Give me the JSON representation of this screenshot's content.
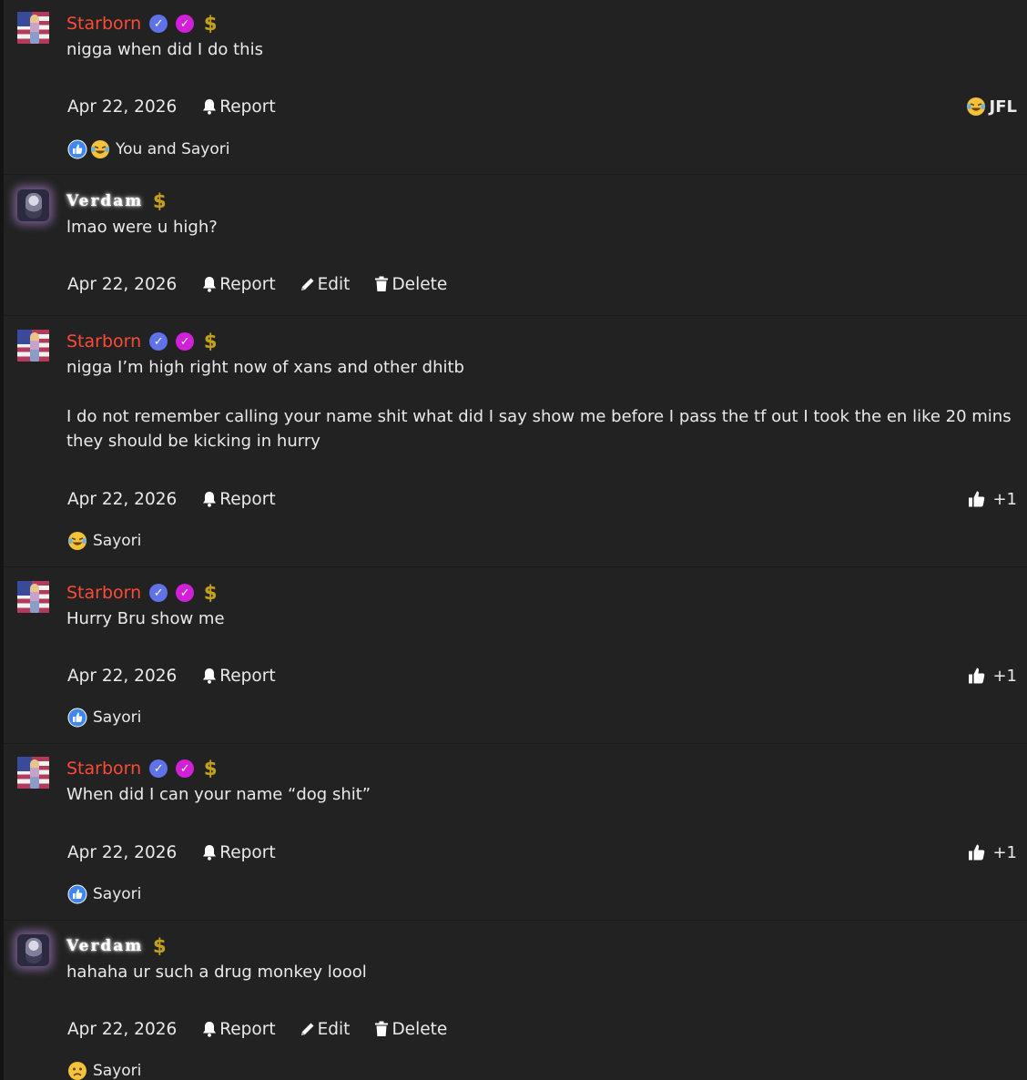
{
  "accent_colors": {
    "starborn_name": "#ff4a37",
    "verified_badge": "#5f72e8",
    "purple_badge": "#d21fd8",
    "dollar_badge": "#c2a020",
    "background": "#222222"
  },
  "posts": [
    {
      "author": "Starborn",
      "avatar_icon": "starborn-avatar",
      "badges": [
        "verified-icon",
        "purple-check-icon",
        "dollar-icon"
      ],
      "body": [
        "nigga when did I do this"
      ],
      "date": "Apr 22, 2026",
      "actions": {
        "report": "Report"
      },
      "right_reaction": {
        "icon": "laughing-crying-emoji-icon",
        "label": "JFL"
      },
      "reactions": {
        "icons": [
          "like-icon",
          "laughing-crying-emoji-icon"
        ],
        "text": "You and Sayori"
      }
    },
    {
      "author": "Verdam",
      "avatar_icon": "verdam-avatar",
      "badges": [
        "dollar-icon"
      ],
      "body": [
        "lmao were u high?"
      ],
      "date": "Apr 22, 2026",
      "actions": {
        "report": "Report",
        "edit": "Edit",
        "delete": "Delete"
      }
    },
    {
      "author": "Starborn",
      "avatar_icon": "starborn-avatar",
      "badges": [
        "verified-icon",
        "purple-check-icon",
        "dollar-icon"
      ],
      "body": [
        "nigga I’m high right now of xans and other dhitb",
        "I do not remember calling your name shit what did I say show me before I pass the tf out I took the en like 20 mins they should be kicking in hurry"
      ],
      "date": "Apr 22, 2026",
      "actions": {
        "report": "Report"
      },
      "right_reaction": {
        "icon": "thumbs-up-icon",
        "count": "+1"
      },
      "reactions": {
        "icons": [
          "laughing-crying-emoji-icon"
        ],
        "text": "Sayori"
      }
    },
    {
      "author": "Starborn",
      "avatar_icon": "starborn-avatar",
      "badges": [
        "verified-icon",
        "purple-check-icon",
        "dollar-icon"
      ],
      "body": [
        "Hurry Bru show me"
      ],
      "date": "Apr 22, 2026",
      "actions": {
        "report": "Report"
      },
      "right_reaction": {
        "icon": "thumbs-up-icon",
        "count": "+1"
      },
      "reactions": {
        "icons": [
          "like-icon"
        ],
        "text": "Sayori"
      }
    },
    {
      "author": "Starborn",
      "avatar_icon": "starborn-avatar",
      "badges": [
        "verified-icon",
        "purple-check-icon",
        "dollar-icon"
      ],
      "body": [
        "When did I can your name “dog shit”"
      ],
      "date": "Apr 22, 2026",
      "actions": {
        "report": "Report"
      },
      "right_reaction": {
        "icon": "thumbs-up-icon",
        "count": "+1"
      },
      "reactions": {
        "icons": [
          "like-icon"
        ],
        "text": "Sayori"
      }
    },
    {
      "author": "Verdam",
      "avatar_icon": "verdam-avatar",
      "badges": [
        "dollar-icon"
      ],
      "body": [
        "hahaha ur such a drug monkey loool"
      ],
      "date": "Apr 22, 2026",
      "actions": {
        "report": "Report",
        "edit": "Edit",
        "delete": "Delete"
      },
      "reactions": {
        "icons": [
          "worried-face-emoji-icon"
        ],
        "text": "Sayori"
      }
    }
  ]
}
